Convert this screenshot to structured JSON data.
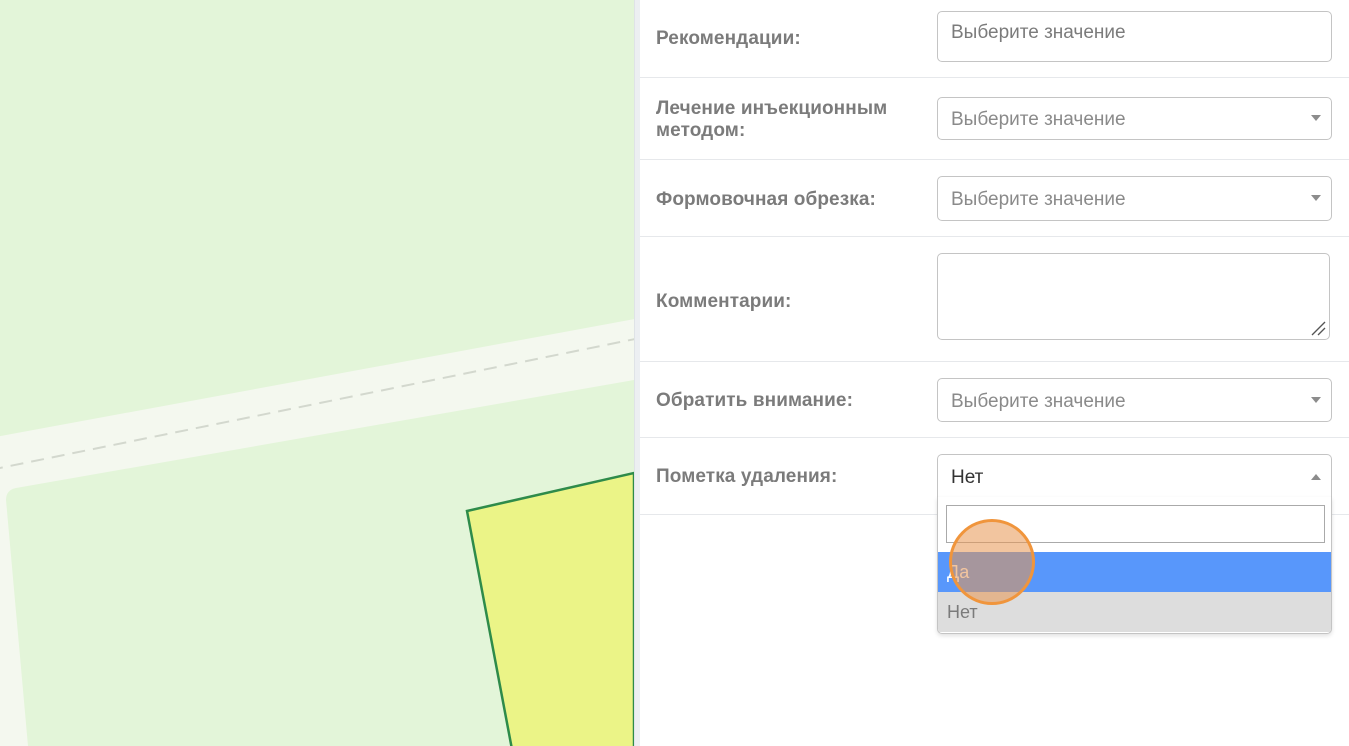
{
  "form": {
    "recommendations": {
      "label": "Рекомендации:",
      "placeholder": "Выберите значение"
    },
    "injection": {
      "label_line1": "Лечение инъекционным",
      "label_line2": "методом:",
      "placeholder": "Выберите значение"
    },
    "pruning": {
      "label": "Формовочная обрезка:",
      "placeholder": "Выберите значение"
    },
    "comments": {
      "label": "Комментарии:",
      "value": ""
    },
    "attention": {
      "label": "Обратить внимание:",
      "placeholder": "Выберите значение"
    },
    "deletion": {
      "label": "Пометка удаления:",
      "selected": "Нет",
      "search_value": "",
      "options": [
        "Да",
        "Нет"
      ],
      "highlighted_option": "Да"
    }
  },
  "colors": {
    "map_background": "#e3f5d9",
    "parcel_fill": "#ebf487",
    "parcel_border": "#2e8b4a",
    "highlight": "#5897fb",
    "cursor": "#f0953c"
  },
  "icons": {
    "select_caret": "chevron-down-icon",
    "open_caret": "chevron-up-icon",
    "textarea_grip": "resize-grip-icon"
  }
}
